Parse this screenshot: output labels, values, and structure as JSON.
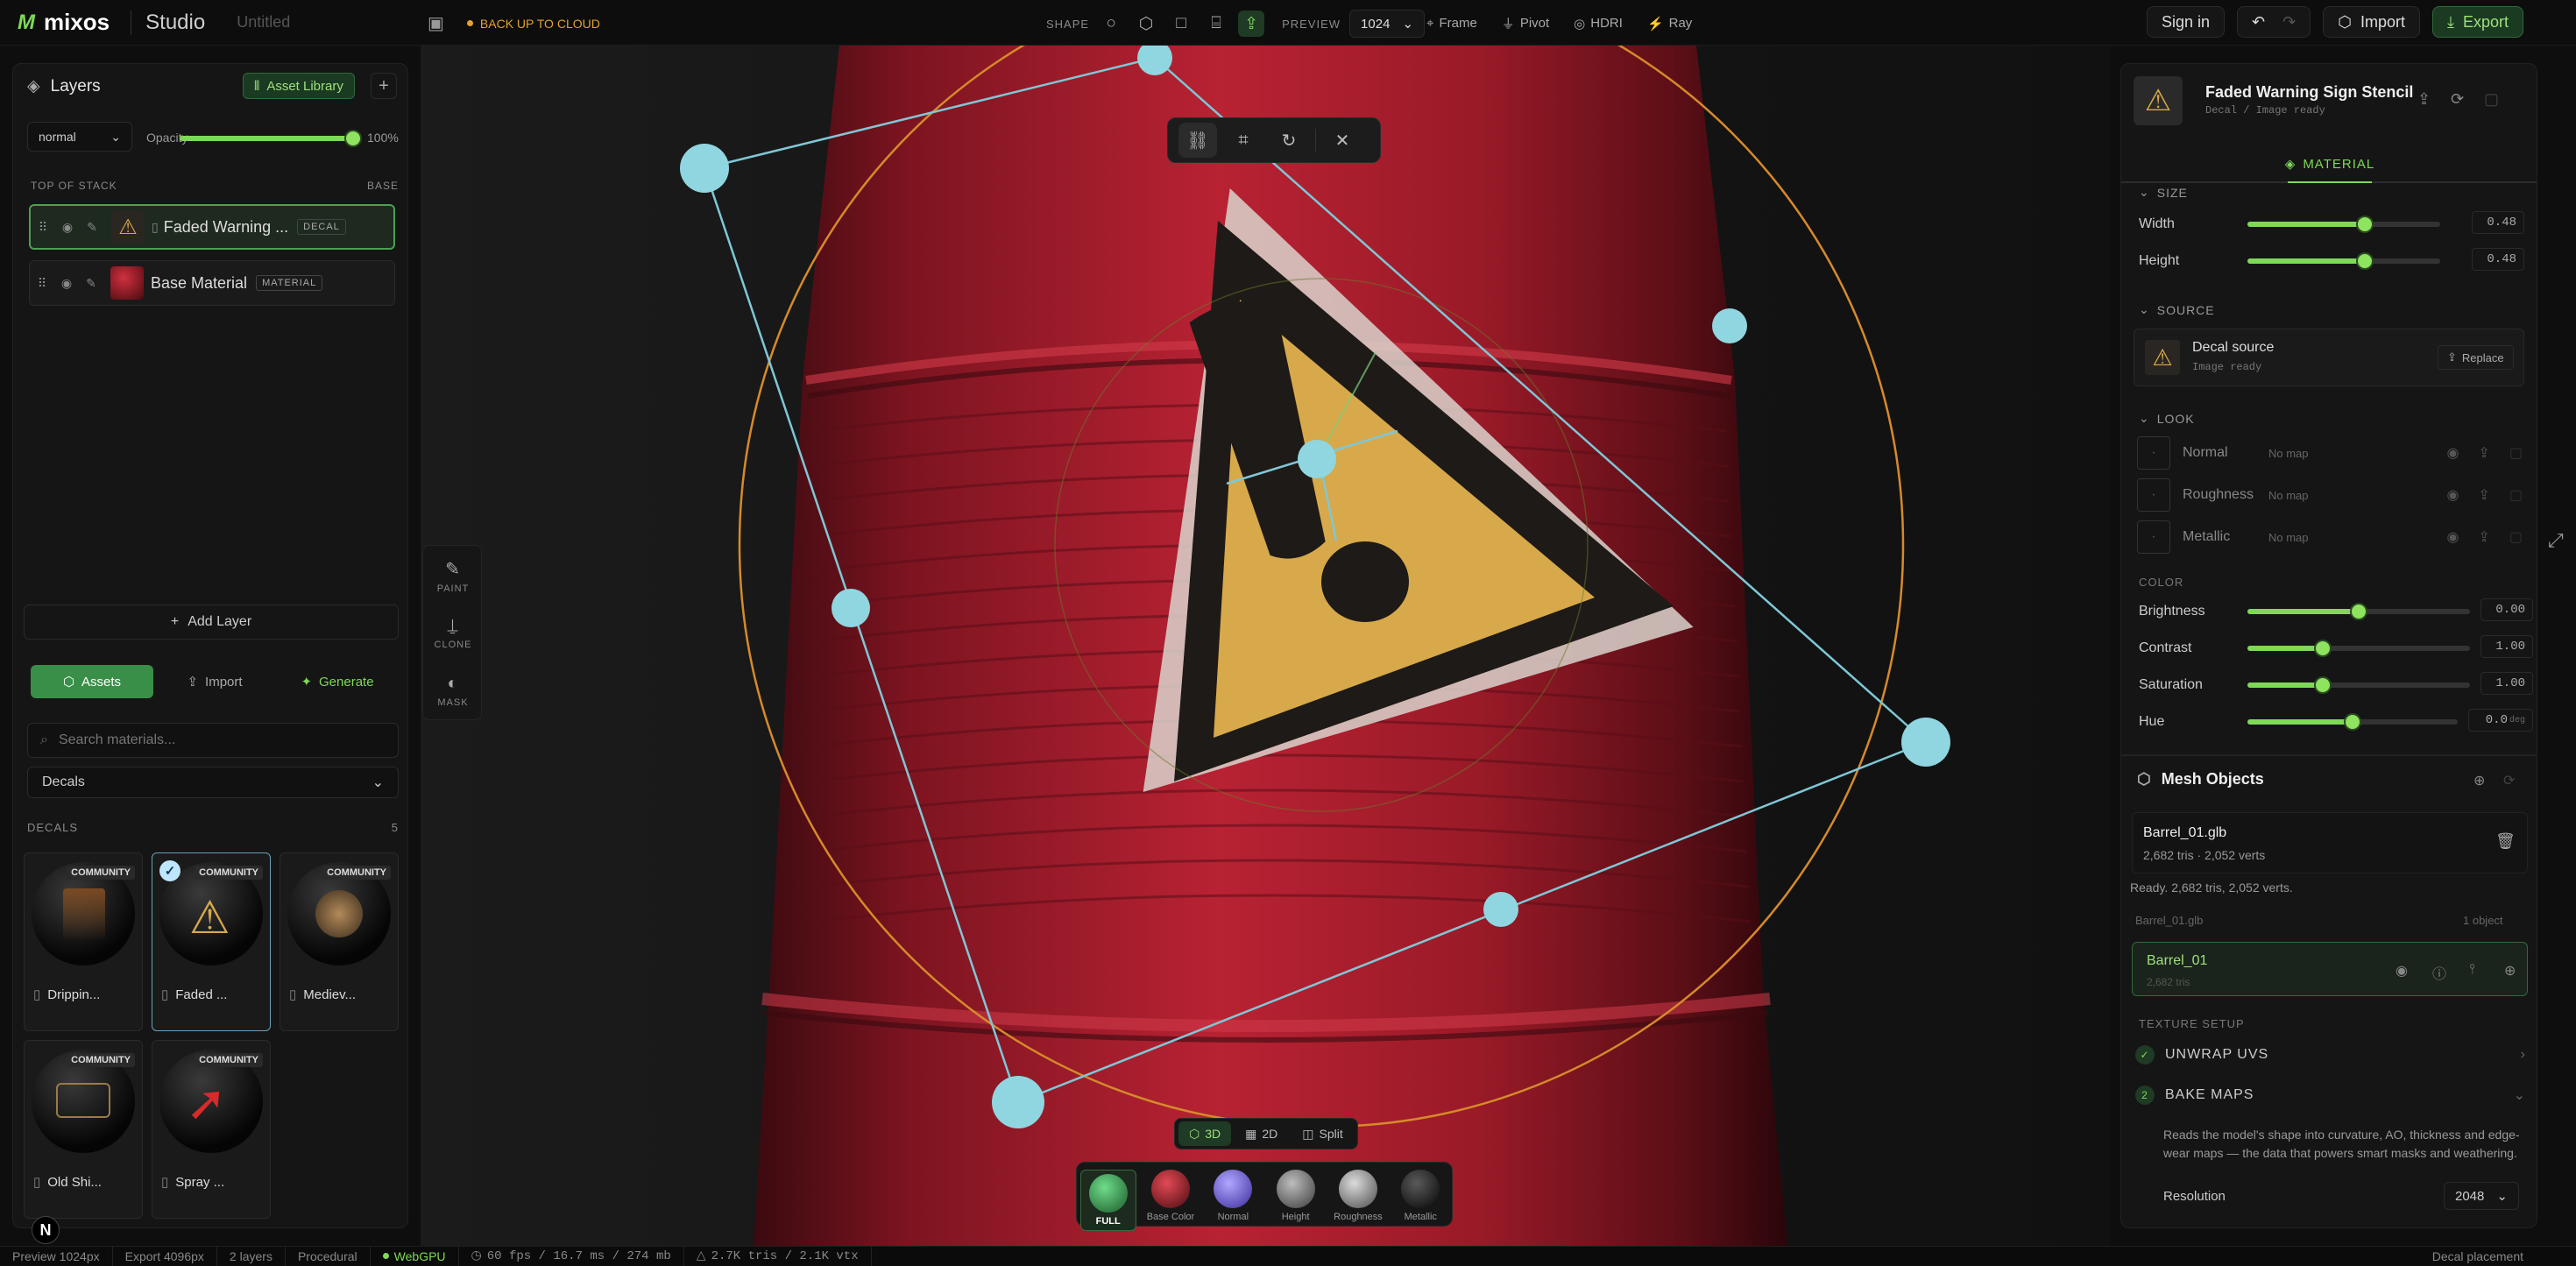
{
  "app": {
    "logo_mark": "M",
    "name": "mixos",
    "product": "Studio",
    "doc_title": "Untitled",
    "cloud_label": "BACK UP TO CLOUD"
  },
  "topbar": {
    "shape_label": "SHAPE",
    "preview_label": "PREVIEW",
    "preview_value": "1024",
    "frame_label": "Frame",
    "pivot_label": "Pivot",
    "hdri_label": "HDRI",
    "ray_label": "Ray",
    "sign_in": "Sign in",
    "import": "Import",
    "export": "Export"
  },
  "layers_panel": {
    "title": "Layers",
    "asset_library": "Asset Library",
    "blend_mode": "normal",
    "opacity_label": "Opacity",
    "opacity_value": "100%",
    "opacity_fraction": 1.0,
    "stack_top": "TOP OF STACK",
    "stack_base": "BASE",
    "layers": [
      {
        "name": "Faded Warning ...",
        "type": "DECAL",
        "selected": true
      },
      {
        "name": "Base Material",
        "type": "MATERIAL",
        "selected": false
      }
    ],
    "add_layer": "Add Layer"
  },
  "assets_panel": {
    "tabs": [
      "Assets",
      "Import",
      "Generate"
    ],
    "search_placeholder": "Search materials...",
    "category": "Decals",
    "section_label": "DECALS",
    "section_count": "5",
    "cards": [
      {
        "name": "Drippin...",
        "tag": "COMMUNITY"
      },
      {
        "name": "Faded ...",
        "tag": "COMMUNITY"
      },
      {
        "name": "Mediev...",
        "tag": "COMMUNITY"
      },
      {
        "name": "Old Shi...",
        "tag": "COMMUNITY"
      },
      {
        "name": "Spray ...",
        "tag": "COMMUNITY"
      }
    ]
  },
  "tools": {
    "paint": "PAINT",
    "clone": "CLONE",
    "mask": "MASK"
  },
  "viewport": {
    "modes": [
      "3D",
      "2D",
      "Split"
    ],
    "channels": [
      "FULL",
      "Base Color",
      "Normal",
      "Height",
      "Roughness",
      "Metallic"
    ],
    "channel_colors": [
      "#2f8f4a",
      "#8a1a20",
      "#6a6ae6",
      "#7a7a7a",
      "#8a8a8a",
      "#1a1a1a"
    ]
  },
  "inspector": {
    "title": "Faded Warning Sign Stencil",
    "subtitle": "Decal / Image ready",
    "tab": "MATERIAL",
    "size_label": "SIZE",
    "width_label": "Width",
    "width_value": "0.48",
    "width_fraction": 0.61,
    "height_label": "Height",
    "height_value": "0.48",
    "height_fraction": 0.61,
    "source_label": "SOURCE",
    "source_name": "Decal source",
    "source_status": "Image ready",
    "replace": "Replace",
    "look_label": "LOOK",
    "look_rows": [
      {
        "name": "Normal",
        "value": "No map"
      },
      {
        "name": "Roughness",
        "value": "No map"
      },
      {
        "name": "Metallic",
        "value": "No map"
      }
    ],
    "color_label": "COLOR",
    "brightness_label": "Brightness",
    "brightness_value": "0.00",
    "brightness_fraction": 0.5,
    "contrast_label": "Contrast",
    "contrast_value": "1.00",
    "contrast_fraction": 0.34,
    "saturation_label": "Saturation",
    "saturation_value": "1.00",
    "saturation_fraction": 0.34,
    "hue_label": "Hue",
    "hue_value": "0.0",
    "hue_unit": "deg",
    "hue_fraction": 0.5,
    "mesh_title": "Mesh Objects",
    "mesh_file": "Barrel_01.glb",
    "mesh_stats": "2,682 tris · 2,052 verts",
    "ready_text": "Ready. 2,682 tris, 2,052 verts.",
    "mesh_group": "Barrel_01.glb",
    "mesh_group_count": "1 object",
    "object_name": "Barrel_01",
    "object_tris": "2,682 tris",
    "texture_setup": "TEXTURE SETUP",
    "unwrap": "UNWRAP UVS",
    "bake_num": "2",
    "bake": "BAKE MAPS",
    "bake_desc": "Reads the model's shape into curvature, AO, thickness and edge-wear maps — the data that powers smart masks and weathering.",
    "resolution_label": "Resolution",
    "resolution_value": "2048"
  },
  "status": {
    "preview": "Preview 1024px",
    "export": "Export 4096px",
    "layers": "2 layers",
    "procedural": "Procedural",
    "backend": "WebGPU",
    "perf": "60 fps / 16.7 ms / 274 mb",
    "geo": "2.7K tris / 2.1K vtx",
    "mode": "Decal placement"
  }
}
